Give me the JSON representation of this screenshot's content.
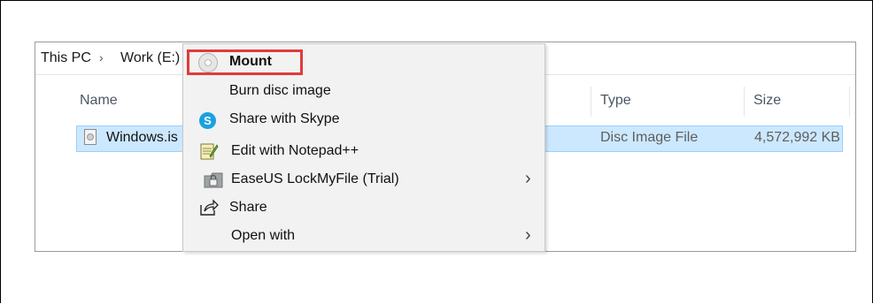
{
  "breadcrumb": {
    "this_pc": "This PC",
    "separator": "›",
    "drive": "Work (E:)"
  },
  "columns": {
    "name": "Name",
    "type": "Type",
    "size": "Size"
  },
  "file": {
    "name": "Windows.is",
    "type": "Disc Image File",
    "size": "4,572,992 KB",
    "icon": "disc-image-file-icon"
  },
  "context_menu": {
    "items": [
      {
        "label": "Mount",
        "icon": "disc-icon",
        "bold": true
      },
      {
        "label": "Burn disc image",
        "icon": ""
      },
      {
        "label": "Share with Skype",
        "icon": "skype-icon"
      },
      {
        "label": "Edit with Notepad++",
        "icon": "notepad-plus-plus-icon"
      },
      {
        "label": "EaseUS LockMyFile (Trial)",
        "icon": "lock-icon",
        "submenu": true
      },
      {
        "label": "Share",
        "icon": "share-icon"
      },
      {
        "label": "Open with",
        "icon": "",
        "submenu": true
      }
    ],
    "submenu_glyph": "›"
  },
  "colors": {
    "selection": "#cce8ff",
    "highlight_box": "#e23b3b",
    "skype": "#1aa1e1"
  }
}
